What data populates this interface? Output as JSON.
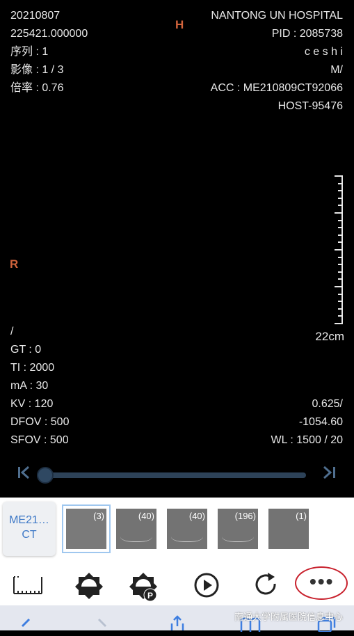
{
  "overlay": {
    "top_left": [
      "20210807",
      "225421.000000",
      "序列 : 1",
      "影像 : 1 / 3",
      "倍率 : 0.76"
    ],
    "top_right": [
      "NANTONG UN HOSPITAL",
      "PID : 2085738",
      "c e s h i",
      "M/",
      "ACC : ME210809CT92066",
      "HOST-95476"
    ],
    "orientation_top": "H",
    "orientation_left": "R",
    "bottom_left": [
      "/",
      "GT : 0",
      "TI : 2000",
      "mA : 30",
      "KV : 120",
      "DFOV : 500",
      "SFOV : 500"
    ],
    "bottom_right": [
      "0.625/",
      "-1054.60",
      "WL : 1500 / 20"
    ],
    "scale_label": "22cm"
  },
  "slider": {
    "first_icon": "skip-to-first-icon",
    "last_icon": "skip-to-last-icon",
    "position_fraction": 0.0
  },
  "series": {
    "tab_line1": "ME21…",
    "tab_line2": "CT",
    "thumbnails": [
      {
        "count": "(3)",
        "selected": true
      },
      {
        "count": "(40)",
        "selected": false
      },
      {
        "count": "(40)",
        "selected": false
      },
      {
        "count": "(196)",
        "selected": false
      },
      {
        "count": "(1)",
        "selected": false
      }
    ]
  },
  "toolbar": {
    "icons": [
      "measure-ruler-icon",
      "window-level-icon",
      "window-level-preset-icon",
      "play-icon",
      "reset-icon",
      "more-icon"
    ],
    "more_label": "•••"
  },
  "browser": {
    "watermark": "南通大学附属医院信息中心",
    "icons": [
      "back-icon",
      "forward-icon",
      "share-icon",
      "bookmarks-icon",
      "tabs-icon"
    ]
  },
  "colors": {
    "orientation": "#d2643c",
    "accent": "#3d78c6",
    "highlight_circle": "#c8202c",
    "slider_track": "#2d4258"
  }
}
